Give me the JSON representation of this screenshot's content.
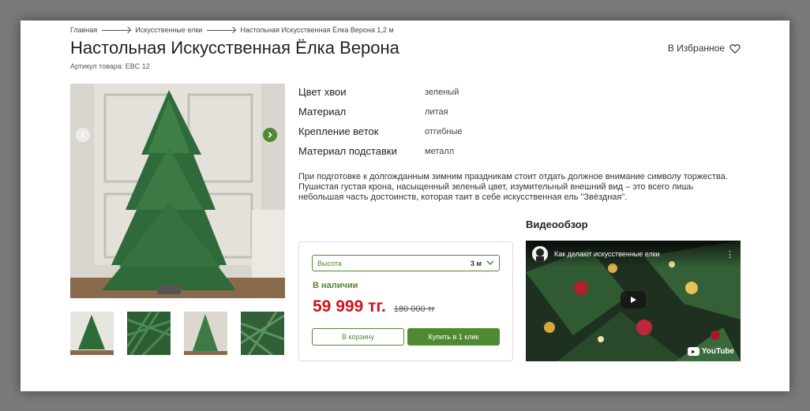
{
  "breadcrumb": [
    "Главная",
    "Искусственные елки",
    "Настольная Искусственная Ёлка Верона 1,2 м"
  ],
  "product": {
    "title": "Настольная Искусственная Ёлка Верона",
    "sku": "Артикул товара: EBC 12"
  },
  "favorite_label": "В Избранное",
  "specs": [
    {
      "name": "Цвет хвои",
      "value": "зеленый"
    },
    {
      "name": "Материал",
      "value": "литая"
    },
    {
      "name": "Крепление веток",
      "value": "отгибные"
    },
    {
      "name": "Материал подставки",
      "value": "металл"
    }
  ],
  "description": "При подготовке к долгожданным зимним праздникам стоит отдать должное внимание символу торжества. Пушистая густая крона, насыщенный зеленый цвет, изумительный внешний вид – это всего лишь небольшая часть достоинств, которая таит в себе искусственная ель \"Звёздная\".",
  "buy": {
    "height_label": "Высота",
    "height_value": "3 м",
    "stock": "В наличии",
    "price": "59 999 тг.",
    "old_price": "180 000 тг",
    "cart_label": "В корзину",
    "buy_label": "Купить в 1 клик"
  },
  "video": {
    "section_title": "Видеообзор",
    "title": "Как делают искусственные елки",
    "brand": "YouTube"
  },
  "colors": {
    "accent_green": "#4f8a33",
    "price_red": "#d0121b"
  },
  "icons": {
    "favorite": "heart-icon",
    "prev": "chevron-left-icon",
    "next": "chevron-right-icon",
    "select": "chevron-down-icon",
    "play": "play-icon",
    "menu": "kebab-menu-icon"
  }
}
